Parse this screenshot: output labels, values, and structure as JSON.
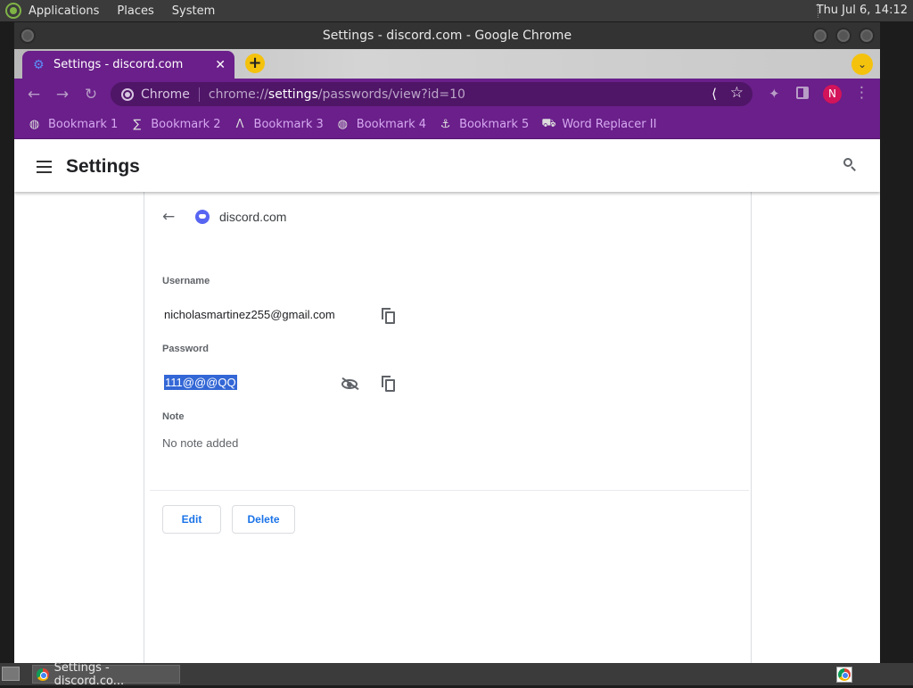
{
  "top_panel": {
    "menus": [
      "Applications",
      "Places",
      "System"
    ],
    "clock": "Thu Jul  6, 14:12"
  },
  "window": {
    "title": "Settings - discord.com - Google Chrome"
  },
  "tab": {
    "title": "Settings - discord.com",
    "close": "✕"
  },
  "omnibox": {
    "chip": "Chrome",
    "url_scheme": "chrome://",
    "url_host": "settings",
    "url_path": "/passwords/view?id=10"
  },
  "profile": {
    "initial": "N"
  },
  "bookmarks": [
    {
      "icon": "globe-icon",
      "glyph": "◍",
      "label": "Bookmark 1"
    },
    {
      "icon": "bookmark-icon",
      "glyph": "∑",
      "label": "Bookmark 2"
    },
    {
      "icon": "bookmark-icon",
      "glyph": "Λ",
      "label": "Bookmark 3"
    },
    {
      "icon": "globe-icon",
      "glyph": "◍",
      "label": "Bookmark 4"
    },
    {
      "icon": "bookmark-icon",
      "glyph": "⚓",
      "label": "Bookmark 5"
    },
    {
      "icon": "word-replacer-icon",
      "glyph": "⛟",
      "label": "Word Replacer II"
    }
  ],
  "settings": {
    "title": "Settings"
  },
  "password_detail": {
    "site": "discord.com",
    "username_label": "Username",
    "username": "nicholasmartinez255@gmail.com",
    "password_label": "Password",
    "password": "111@@@QQ",
    "note_label": "Note",
    "note": "No note added",
    "edit_label": "Edit",
    "delete_label": "Delete"
  },
  "taskbar": {
    "task_title": "Settings - discord.co..."
  },
  "colors": {
    "theme_purple": "#6a1f8a",
    "accent_yellow": "#f4c20d",
    "link_blue": "#1a73e8",
    "selection_blue": "#3367d6",
    "avatar_pink": "#d3145a"
  }
}
